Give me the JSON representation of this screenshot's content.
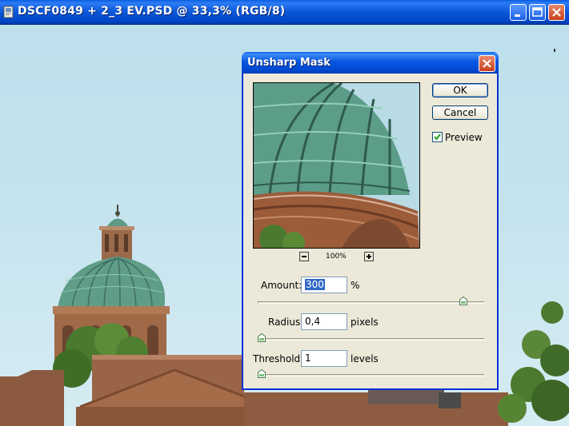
{
  "window": {
    "title": "DSCF0849 + 2_3 EV.PSD @ 33,3% (RGB/8)",
    "buttons": [
      "minimize",
      "maximize",
      "close"
    ]
  },
  "dialog": {
    "title": "Unsharp Mask",
    "ok_label": "OK",
    "cancel_label": "Cancel",
    "preview_label": "Preview",
    "preview_checked": true,
    "zoom_level": "100%",
    "amount": {
      "label": "Amount:",
      "value": "300",
      "unit": "%",
      "slider_fraction": 0.92
    },
    "radius": {
      "label": "Radius:",
      "value": "0,4",
      "unit": "pixels",
      "slider_fraction": 0.0
    },
    "threshold": {
      "label": "Threshold:",
      "value": "1",
      "unit": "levels",
      "slider_fraction": 0.0
    }
  },
  "icons": [
    "photoshop-document-icon",
    "minimize-icon",
    "maximize-icon",
    "close-icon",
    "zoom-out-icon",
    "zoom-in-icon",
    "check-icon",
    "slider-thumb-icon"
  ],
  "colors": {
    "title_bar": "#0a57d8",
    "dialog_bg": "#ece9d8",
    "close_button": "#c8401d",
    "selection": "#316ac5"
  }
}
